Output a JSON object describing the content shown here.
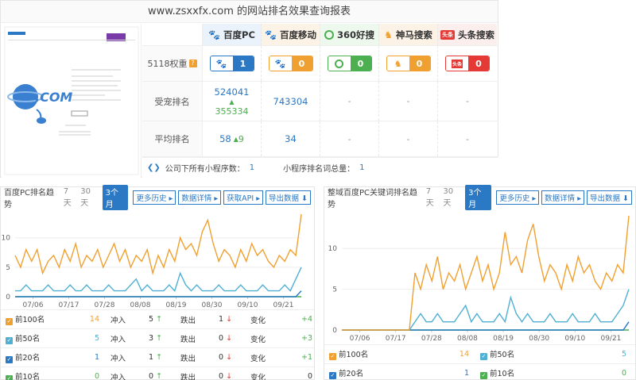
{
  "report": {
    "title": "www.zsxxfx.com 的网站排名效果查询报表",
    "engines": [
      {
        "name": "百度PC",
        "icon": "paw-icon",
        "color": "#2b78c4",
        "weight": "1"
      },
      {
        "name": "百度移动",
        "icon": "paw-icon",
        "color": "#f0a030",
        "weight": "0"
      },
      {
        "name": "360好搜",
        "icon": "360-icon",
        "color": "#4caf50",
        "weight": "0"
      },
      {
        "name": "神马搜索",
        "icon": "horse-icon",
        "color": "#f0a030",
        "weight": "0"
      },
      {
        "name": "头条搜索",
        "icon": "toutiao-icon",
        "color": "#e53935",
        "weight": "0",
        "icon_text": "头条"
      }
    ],
    "row_labels": {
      "weight": "5118权重",
      "weight_help": "?",
      "traffic": "受宠排名",
      "avg": "平均排名"
    },
    "traffic": {
      "pc_1": "524041",
      "pc_2": "355334",
      "mobile": "743304",
      "other": "-"
    },
    "avg": {
      "pc": "58",
      "pc_up": "9",
      "mobile": "34",
      "other": "-"
    },
    "footer": {
      "mini_label": "公司下所有小程序数：",
      "mini_value": "1",
      "words_label": "小程序排名词总量：",
      "words_value": "1"
    },
    "thumb": {
      "domain_text": ".COM"
    }
  },
  "left_panel": {
    "title": "百度PC排名趋势",
    "tabs": [
      "7天",
      "30天",
      "3个月"
    ],
    "buttons": [
      "更多历史",
      "数据详情",
      "获取API",
      "导出数据"
    ],
    "xticks": [
      "07/06",
      "07/17",
      "07/28",
      "08/08",
      "08/19",
      "08/30",
      "09/10",
      "09/21"
    ],
    "yticks": [
      "0",
      "5",
      "10"
    ],
    "rows": [
      {
        "label": "前100名",
        "color": "#f0a030",
        "count": "14",
        "in_label": "冲入",
        "in": "5",
        "out_label": "跌出",
        "out": "1",
        "chg_label": "变化",
        "chg": "+4"
      },
      {
        "label": "前50名",
        "color": "#4fb0d4",
        "count": "5",
        "in_label": "冲入",
        "in": "3",
        "out_label": "跌出",
        "out": "0",
        "chg_label": "变化",
        "chg": "+3"
      },
      {
        "label": "前20名",
        "color": "#2b78c4",
        "count": "1",
        "in_label": "冲入",
        "in": "1",
        "out_label": "跌出",
        "out": "0",
        "chg_label": "变化",
        "chg": "+1"
      },
      {
        "label": "前10名",
        "color": "#4caf50",
        "count": "0",
        "in_label": "冲入",
        "in": "0",
        "out_label": "跌出",
        "out": "0",
        "chg_label": "变化",
        "chg": "0"
      }
    ]
  },
  "right_panel": {
    "title": "整域百度PC关键词排名趋势",
    "tabs": [
      "7天",
      "30天",
      "3个月"
    ],
    "buttons": [
      "更多历史",
      "数据详情",
      "导出数据"
    ],
    "xticks": [
      "07/06",
      "07/17",
      "07/28",
      "08/08",
      "08/19",
      "08/30",
      "09/10",
      "09/21"
    ],
    "yticks": [
      "0",
      "5",
      "10"
    ],
    "rows": [
      {
        "label": "前100名",
        "color": "#f0a030",
        "value": "14",
        "label2": "前50名",
        "color2": "#4fb0d4",
        "value2": "5"
      },
      {
        "label": "前20名",
        "color": "#2b78c4",
        "value": "1",
        "label2": "前10名",
        "color2": "#4caf50",
        "value2": "0"
      }
    ]
  },
  "chart_data": [
    {
      "type": "line",
      "ylim": [
        0,
        14
      ],
      "x": [
        "07/06",
        "07/17",
        "07/28",
        "08/08",
        "08/19",
        "08/30",
        "09/10",
        "09/21"
      ],
      "series": [
        {
          "name": "前100名",
          "color": "#f0a030",
          "values": [
            7,
            5,
            8,
            6,
            8,
            4,
            6,
            7,
            5,
            8,
            6,
            9,
            5,
            7,
            6,
            8,
            5,
            7,
            9,
            6,
            8,
            5,
            7,
            6,
            8,
            4,
            7,
            5,
            8,
            6,
            10,
            8,
            9,
            7,
            11,
            13,
            9,
            6,
            8,
            7,
            5,
            8,
            6,
            9,
            7,
            8,
            6,
            5,
            7,
            6,
            8,
            7,
            14
          ]
        },
        {
          "name": "前50名",
          "color": "#4fb0d4",
          "values": [
            1,
            1,
            2,
            1,
            1,
            1,
            2,
            1,
            1,
            1,
            2,
            1,
            1,
            2,
            1,
            1,
            1,
            2,
            1,
            1,
            1,
            2,
            3,
            1,
            2,
            1,
            1,
            1,
            2,
            1,
            4,
            2,
            1,
            2,
            1,
            1,
            1,
            2,
            1,
            1,
            1,
            2,
            1,
            1,
            1,
            2,
            1,
            1,
            1,
            2,
            1,
            3,
            5
          ]
        },
        {
          "name": "前20名",
          "color": "#2b78c4",
          "values": [
            0,
            0,
            0,
            0,
            0,
            0,
            0,
            0,
            0,
            0,
            0,
            0,
            0,
            0,
            0,
            0,
            0,
            0,
            0,
            0,
            0,
            0,
            0,
            0,
            0,
            0,
            0,
            0,
            0,
            0,
            0,
            0,
            0,
            0,
            0,
            0,
            0,
            0,
            0,
            0,
            0,
            0,
            0,
            0,
            0,
            0,
            0,
            0,
            0,
            0,
            0,
            0,
            1
          ]
        },
        {
          "name": "前10名",
          "color": "#4caf50",
          "values": [
            0,
            0,
            0,
            0,
            0,
            0,
            0,
            0,
            0,
            0,
            0,
            0,
            0,
            0,
            0,
            0,
            0,
            0,
            0,
            0,
            0,
            0,
            0,
            0,
            0,
            0,
            0,
            0,
            0,
            0,
            0,
            0,
            0,
            0,
            0,
            0,
            0,
            0,
            0,
            0,
            0,
            0,
            0,
            0,
            0,
            0,
            0,
            0,
            0,
            0,
            0,
            0,
            0
          ]
        }
      ]
    },
    {
      "type": "line",
      "ylim": [
        0,
        14
      ],
      "x": [
        "07/06",
        "07/17",
        "07/28",
        "08/08",
        "08/19",
        "08/30",
        "09/10",
        "09/21"
      ],
      "series": [
        {
          "name": "前100名",
          "color": "#f0a030",
          "values": [
            0,
            0,
            0,
            0,
            0,
            0,
            0,
            0,
            0,
            0,
            0,
            0,
            0,
            7,
            5,
            8,
            6,
            9,
            5,
            7,
            6,
            8,
            5,
            7,
            9,
            6,
            8,
            5,
            7,
            12,
            8,
            9,
            7,
            11,
            13,
            9,
            6,
            8,
            7,
            5,
            8,
            6,
            9,
            7,
            8,
            6,
            5,
            7,
            6,
            8,
            7,
            14
          ]
        },
        {
          "name": "前50名",
          "color": "#4fb0d4",
          "values": [
            0,
            0,
            0,
            0,
            0,
            0,
            0,
            0,
            0,
            0,
            0,
            0,
            0,
            1,
            2,
            1,
            1,
            2,
            1,
            1,
            1,
            2,
            3,
            1,
            2,
            1,
            1,
            1,
            2,
            1,
            4,
            2,
            1,
            2,
            1,
            1,
            1,
            2,
            1,
            1,
            1,
            2,
            1,
            1,
            1,
            2,
            1,
            1,
            1,
            2,
            3,
            5
          ]
        },
        {
          "name": "前20名",
          "color": "#2b78c4",
          "values": [
            0,
            0,
            0,
            0,
            0,
            0,
            0,
            0,
            0,
            0,
            0,
            0,
            0,
            0,
            0,
            0,
            0,
            0,
            0,
            0,
            0,
            0,
            0,
            0,
            0,
            0,
            0,
            0,
            0,
            0,
            0,
            0,
            0,
            0,
            0,
            0,
            0,
            0,
            0,
            0,
            0,
            0,
            0,
            0,
            0,
            0,
            0,
            0,
            0,
            0,
            0,
            1
          ]
        },
        {
          "name": "前10名",
          "color": "#4caf50",
          "values": [
            0,
            0,
            0,
            0,
            0,
            0,
            0,
            0,
            0,
            0,
            0,
            0,
            0,
            0,
            0,
            0,
            0,
            0,
            0,
            0,
            0,
            0,
            0,
            0,
            0,
            0,
            0,
            0,
            0,
            0,
            0,
            0,
            0,
            0,
            0,
            0,
            0,
            0,
            0,
            0,
            0,
            0,
            0,
            0,
            0,
            0,
            0,
            0,
            0,
            0,
            0,
            0
          ]
        }
      ]
    }
  ]
}
